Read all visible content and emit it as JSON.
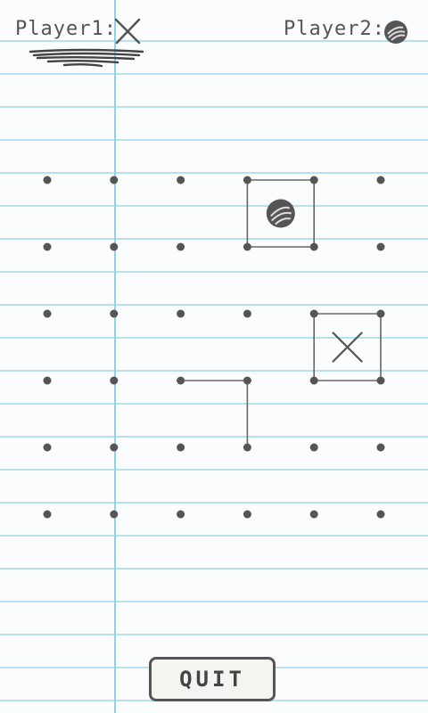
{
  "header": {
    "player1_label": "Player1:",
    "player1_symbol": "x-mark-icon",
    "player2_label": "Player2:",
    "player2_symbol": "scribble-circle-icon",
    "active_player": "Player1"
  },
  "board": {
    "rows": 6,
    "cols": 6,
    "dot_color": "#555555",
    "line_color": "#666666",
    "drawn_lines": [
      {
        "from": [
          0,
          3
        ],
        "to": [
          0,
          4
        ]
      },
      {
        "from": [
          1,
          3
        ],
        "to": [
          1,
          4
        ]
      },
      {
        "from": [
          0,
          3
        ],
        "to": [
          1,
          3
        ]
      },
      {
        "from": [
          0,
          4
        ],
        "to": [
          1,
          4
        ]
      },
      {
        "from": [
          2,
          4
        ],
        "to": [
          2,
          5
        ]
      },
      {
        "from": [
          3,
          4
        ],
        "to": [
          3,
          5
        ]
      },
      {
        "from": [
          2,
          4
        ],
        "to": [
          3,
          4
        ]
      },
      {
        "from": [
          2,
          5
        ],
        "to": [
          3,
          5
        ]
      },
      {
        "from": [
          3,
          2
        ],
        "to": [
          3,
          3
        ]
      },
      {
        "from": [
          3,
          3
        ],
        "to": [
          4,
          3
        ]
      }
    ],
    "captured_boxes": [
      {
        "row": 0,
        "col": 3,
        "owner": "Player2"
      },
      {
        "row": 2,
        "col": 4,
        "owner": "Player1"
      }
    ]
  },
  "footer": {
    "quit_label": "QUIT"
  }
}
